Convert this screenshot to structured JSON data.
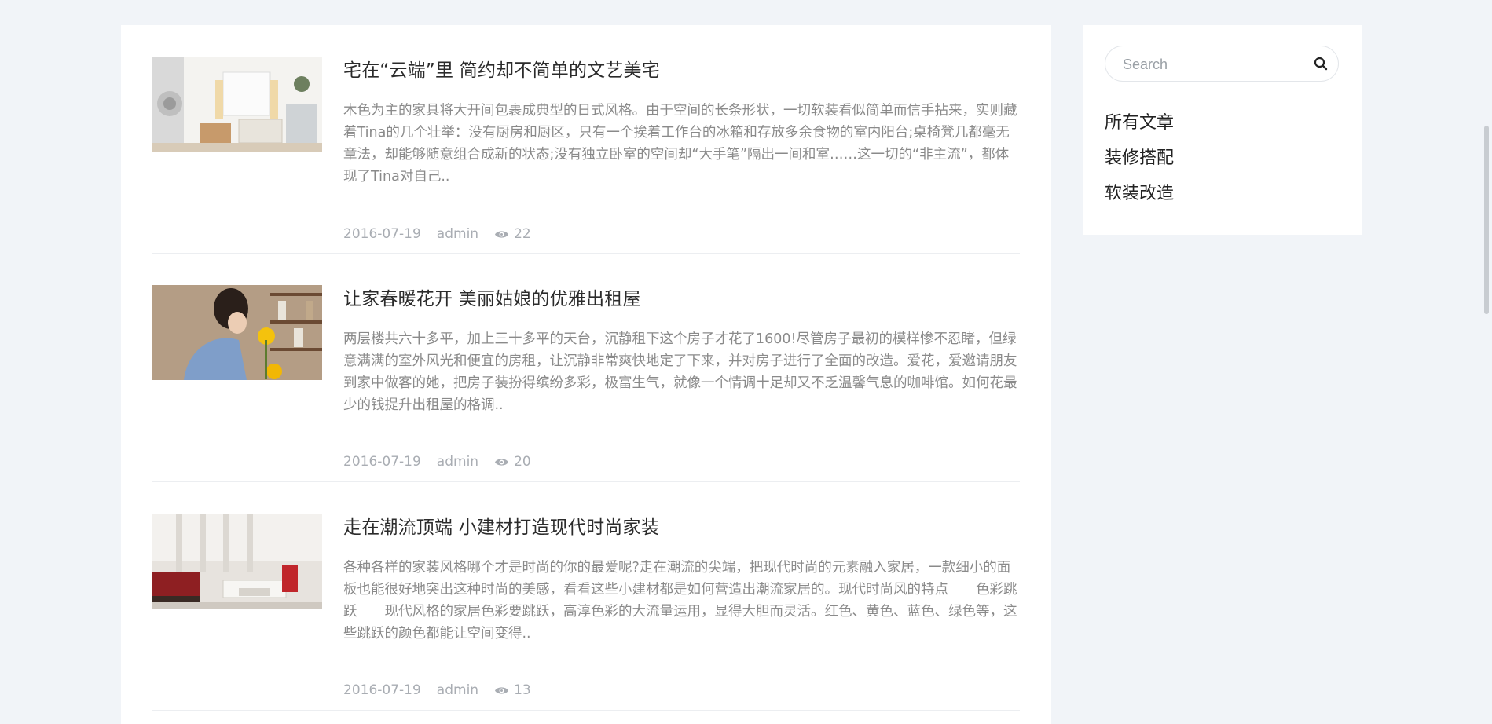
{
  "posts": [
    {
      "title": "宅在“云端”里 简约却不简单的文艺美宅",
      "excerpt": "木色为主的家具将大开间包裹成典型的日式风格。由于空间的长条形状，一切软装看似简单而信手拈来，实则藏着Tina的几个壮举：没有厨房和厨区，只有一个挨着工作台的冰箱和存放多余食物的室内阳台;桌椅凳几都毫无章法，却能够随意组合成新的状态;没有独立卧室的空间却“大手笔”隔出一间和室……这一切的“非主流”，都体现了Tina对自己..",
      "date": "2016-07-19",
      "author": "admin",
      "views": "22"
    },
    {
      "title": "让家春暖花开 美丽姑娘的优雅出租屋",
      "excerpt": "两层楼共六十多平，加上三十多平的天台，沉静租下这个房子才花了1600!尽管房子最初的模样惨不忍睹，但绿意满满的室外风光和便宜的房租，让沉静非常爽快地定了下来，并对房子进行了全面的改造。爱花，爱邀请朋友到家中做客的她，把房子装扮得缤纷多彩，极富生气，就像一个情调十足却又不乏温馨气息的咖啡馆。如何花最少的钱提升出租屋的格调..",
      "date": "2016-07-19",
      "author": "admin",
      "views": "20"
    },
    {
      "title": "走在潮流顶端 小建材打造现代时尚家装",
      "excerpt": "各种各样的家装风格哪个才是时尚的你的最爱呢?走在潮流的尖端，把现代时尚的元素融入家居，一款细小的面板也能很好地突出这种时尚的美感，看看这些小建材都是如何营造出潮流家居的。现代时尚风的特点　　色彩跳跃　　现代风格的家居色彩要跳跃，高淳色彩的大流量运用，显得大胆而灵活。红色、黄色、蓝色、绿色等，这些跳跃的颜色都能让空间变得..",
      "date": "2016-07-19",
      "author": "admin",
      "views": "13"
    }
  ],
  "sidebar": {
    "search_placeholder": "Search",
    "search_icon": "search-icon",
    "categories": [
      "所有文章",
      "装修搭配",
      "软装改造"
    ]
  },
  "icons": {
    "views": "eye-icon"
  },
  "colors": {
    "background": "#f1f4f8",
    "card": "#ffffff",
    "title": "#2b2b2b",
    "excerpt": "#8a8a8a",
    "meta": "#a9adb3"
  }
}
